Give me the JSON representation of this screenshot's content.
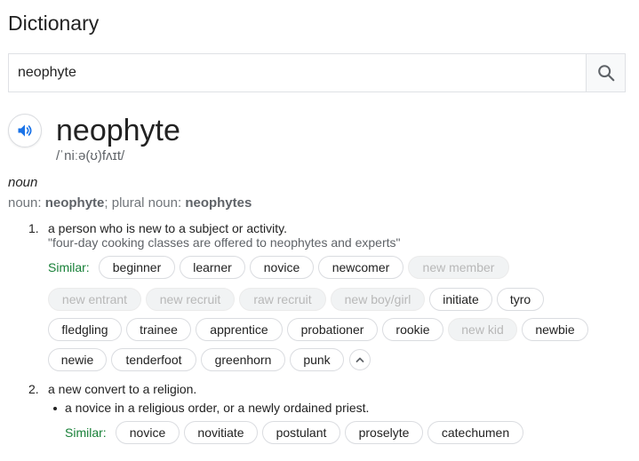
{
  "heading": "Dictionary",
  "search": {
    "value": "neophyte",
    "button_icon": "search-icon"
  },
  "entry": {
    "speaker_icon": "speaker-icon",
    "word": "neophyte",
    "phonetic": "/ˈniːə(ʊ)fʌɪt/",
    "part_of_speech": "noun",
    "forms": {
      "label1": "noun: ",
      "form1": "neophyte",
      "sep": "; plural noun: ",
      "form2": "neophytes"
    }
  },
  "senses": [
    {
      "number": "1.",
      "definition": "a person who is new to a subject or activity.",
      "example": "\"four-day cooking classes are offered to neophytes and experts\"",
      "similar_label": "Similar:",
      "chips": [
        {
          "label": "beginner",
          "enabled": true
        },
        {
          "label": "learner",
          "enabled": true
        },
        {
          "label": "novice",
          "enabled": true
        },
        {
          "label": "newcomer",
          "enabled": true
        },
        {
          "label": "new member",
          "enabled": false
        },
        {
          "label": "new entrant",
          "enabled": false
        },
        {
          "label": "new recruit",
          "enabled": false
        },
        {
          "label": "raw recruit",
          "enabled": false
        },
        {
          "label": "new boy/girl",
          "enabled": false
        },
        {
          "label": "initiate",
          "enabled": true
        },
        {
          "label": "tyro",
          "enabled": true
        },
        {
          "label": "fledgling",
          "enabled": true
        },
        {
          "label": "trainee",
          "enabled": true
        },
        {
          "label": "apprentice",
          "enabled": true
        },
        {
          "label": "probationer",
          "enabled": true
        },
        {
          "label": "rookie",
          "enabled": true
        },
        {
          "label": "new kid",
          "enabled": false
        },
        {
          "label": "newbie",
          "enabled": true
        },
        {
          "label": "newie",
          "enabled": true
        },
        {
          "label": "tenderfoot",
          "enabled": true
        },
        {
          "label": "greenhorn",
          "enabled": true
        },
        {
          "label": "punk",
          "enabled": true
        }
      ],
      "collapse_icon": "chevron-up-icon"
    },
    {
      "number": "2.",
      "definition": "a new convert to a religion.",
      "subsense": {
        "definition": "a novice in a religious order, or a newly ordained priest.",
        "similar_label": "Similar:",
        "chips": [
          {
            "label": "novice",
            "enabled": true
          },
          {
            "label": "novitiate",
            "enabled": true
          },
          {
            "label": "postulant",
            "enabled": true
          },
          {
            "label": "proselyte",
            "enabled": true
          },
          {
            "label": "catechumen",
            "enabled": true
          }
        ]
      }
    }
  ]
}
